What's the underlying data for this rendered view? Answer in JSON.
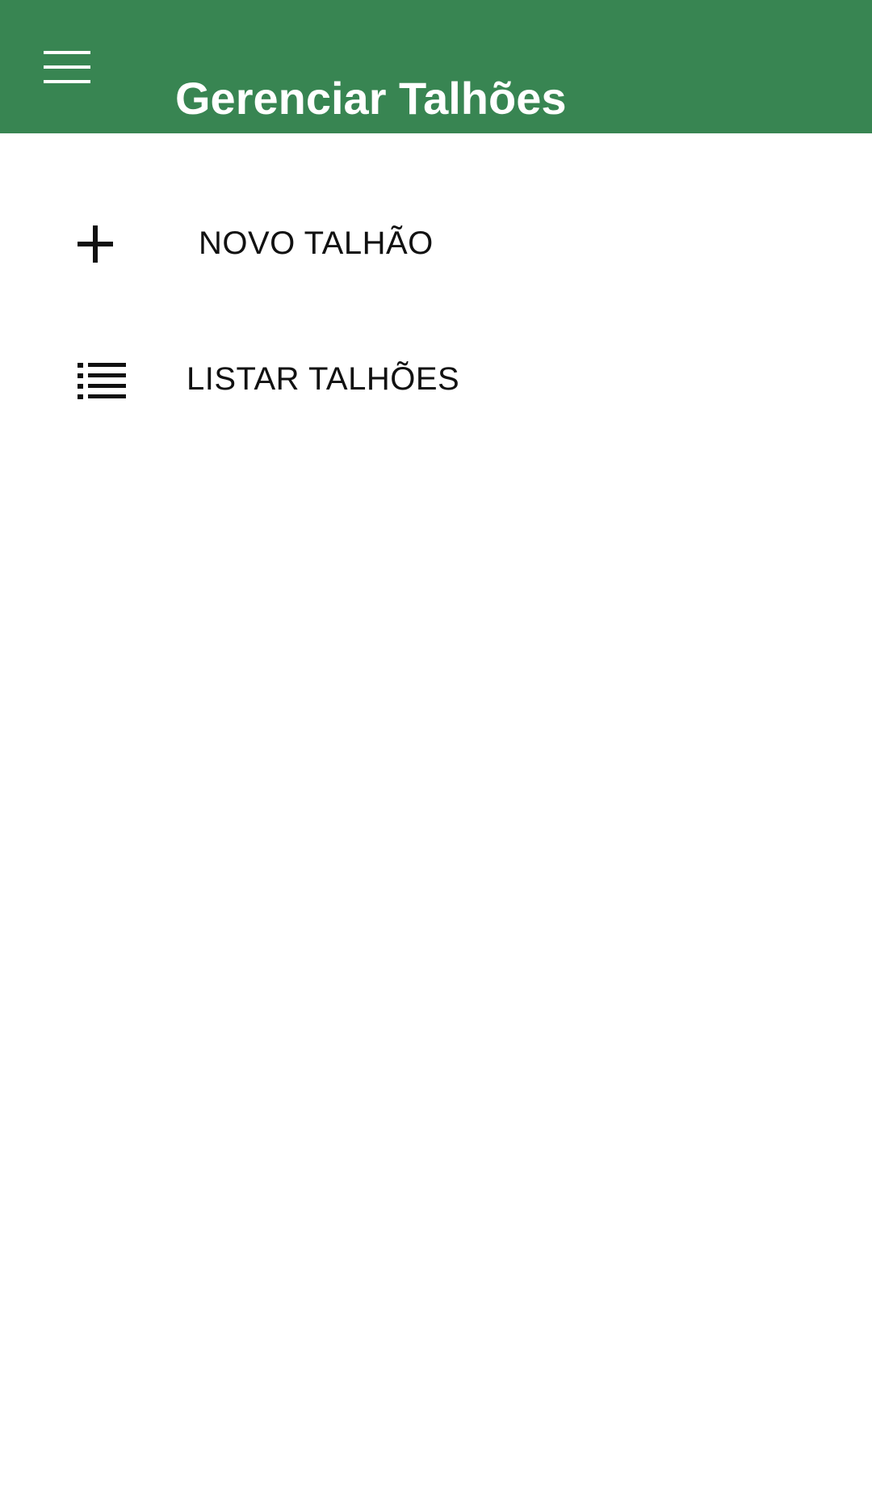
{
  "appbar": {
    "title": "Gerenciar Talhões",
    "menu_icon": "hamburger-menu-icon",
    "background_color": "#388552",
    "title_color": "#ffffff"
  },
  "actions": [
    {
      "label": "NOVO TALHÃO",
      "icon": "plus-icon"
    },
    {
      "label": "LISTAR TALHÕES",
      "icon": "list-icon"
    }
  ],
  "colors": {
    "background": "#ffffff",
    "text": "#111111"
  }
}
